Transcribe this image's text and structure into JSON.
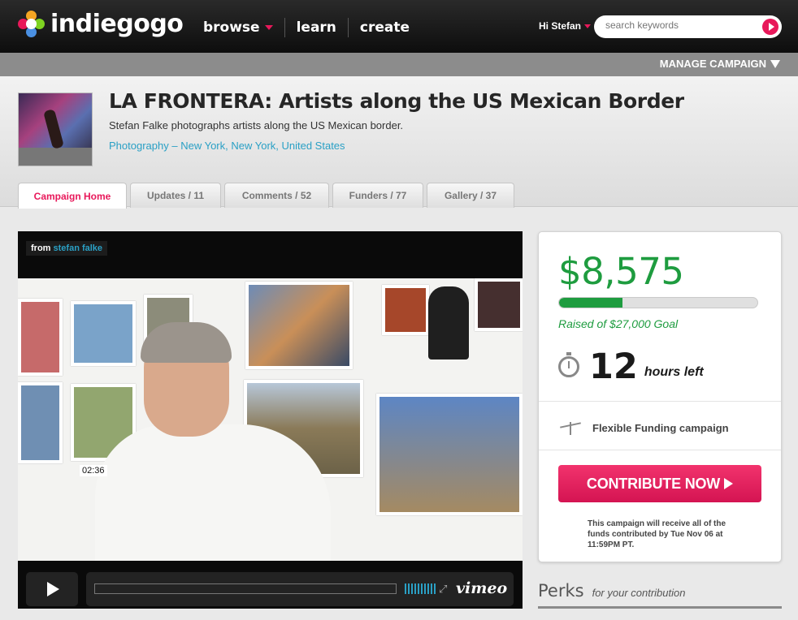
{
  "brand": {
    "name": "indiegogo"
  },
  "nav": {
    "items": [
      {
        "label": "browse"
      },
      {
        "label": "learn"
      },
      {
        "label": "create"
      }
    ],
    "greeting": "Hi Stefan",
    "search_placeholder": "search keywords"
  },
  "manage": {
    "label": "MANAGE CAMPAIGN"
  },
  "campaign": {
    "title": "LA FRONTERA: Artists along the US Mexican Border",
    "subtitle": "Stefan Falke photographs artists along the US Mexican border.",
    "category": "Photography",
    "separator": " – ",
    "location": "New York, New York, United States"
  },
  "tabs": [
    {
      "label": "Campaign Home",
      "active": true
    },
    {
      "label": "Updates / 11"
    },
    {
      "label": "Comments / 52"
    },
    {
      "label": "Funders / 77"
    },
    {
      "label": "Gallery / 37"
    }
  ],
  "video": {
    "from_prefix": "from",
    "from_author": "stefan falke",
    "time": "02:36",
    "player_brand": "vimeo"
  },
  "funding": {
    "amount": "$8,575",
    "progress_fraction": 0.32,
    "goal_text": "Raised of $27,000 Goal",
    "time_left_value": "12",
    "time_left_label": "hours left",
    "funding_type": "Flexible Funding campaign",
    "contribute_label": "CONTRIBUTE NOW",
    "note": "This campaign will receive all of the funds contributed by Tue Nov 06 at 11:59PM PT."
  },
  "perks": {
    "title": "Perks",
    "subtitle": "for your contribution"
  },
  "colors": {
    "accent": "#e8185a",
    "green": "#1e9c3f",
    "link": "#2aa0c5"
  }
}
